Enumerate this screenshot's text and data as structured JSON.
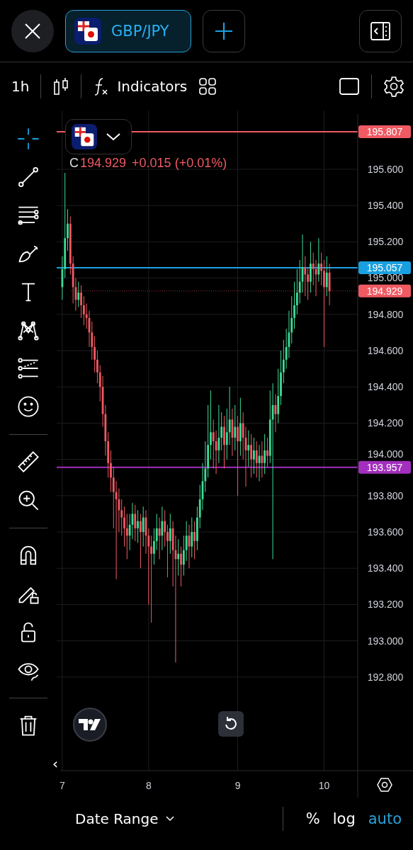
{
  "top_bar": {
    "symbol_tab": {
      "label": "GBP/JPY"
    }
  },
  "toolbar": {
    "interval": "1h",
    "indicators": "Indicators"
  },
  "drawing_tools": [
    {
      "kind": "crosshair",
      "selected": true
    },
    {
      "kind": "trend_line",
      "selected": false
    },
    {
      "kind": "fib",
      "selected": false
    },
    {
      "kind": "brush",
      "selected": false
    },
    {
      "kind": "text",
      "selected": false
    },
    {
      "kind": "pattern",
      "selected": false
    },
    {
      "kind": "projection",
      "selected": false
    },
    {
      "kind": "emoji",
      "selected": false
    },
    {
      "kind": "divider"
    },
    {
      "kind": "ruler",
      "selected": false
    },
    {
      "kind": "zoom",
      "selected": false
    },
    {
      "kind": "divider"
    },
    {
      "kind": "magnet",
      "selected": false
    },
    {
      "kind": "lock_drawing",
      "selected": false
    },
    {
      "kind": "lock",
      "selected": false
    },
    {
      "kind": "hide",
      "selected": false
    },
    {
      "kind": "divider"
    },
    {
      "kind": "trash",
      "selected": false
    }
  ],
  "chart": {
    "legend": {
      "label": "C",
      "close": "194.929",
      "change": "+0.015 (+0.01%)"
    },
    "chart_data": {
      "type": "candlestick",
      "categories": [
        "7",
        null,
        null,
        null,
        null,
        null,
        null,
        null,
        null,
        null,
        null,
        null,
        null,
        null,
        null,
        null,
        null,
        null,
        null,
        null,
        null,
        null,
        null,
        null,
        null,
        null,
        null,
        null,
        null,
        null,
        null,
        null,
        "8",
        null,
        null,
        null,
        null,
        null,
        null,
        null,
        null,
        null,
        null,
        null,
        null,
        null,
        null,
        null,
        null,
        null,
        null,
        null,
        null,
        null,
        null,
        null,
        null,
        null,
        null,
        null,
        null,
        null,
        null,
        null,
        null,
        "9",
        null,
        null,
        null,
        null,
        null,
        null,
        null,
        null,
        null,
        null,
        null,
        null,
        null,
        null,
        null,
        null,
        null,
        null,
        null,
        null,
        null,
        null,
        null,
        null,
        null,
        null,
        null,
        null,
        null,
        null,
        null,
        "10",
        null,
        null
      ],
      "ohlc": [
        [
          194.95,
          195.12,
          194.88,
          195.05
        ],
        [
          195.05,
          195.58,
          195.0,
          195.22
        ],
        [
          195.22,
          195.38,
          195.15,
          195.3
        ],
        [
          195.3,
          195.34,
          195.02,
          195.08
        ],
        [
          195.08,
          195.12,
          194.86,
          194.95
        ],
        [
          194.95,
          195.0,
          194.82,
          194.88
        ],
        [
          194.88,
          194.98,
          194.84,
          194.92
        ],
        [
          194.92,
          194.96,
          194.78,
          194.85
        ],
        [
          194.85,
          194.9,
          194.74,
          194.8
        ],
        [
          194.8,
          194.86,
          194.72,
          194.78
        ],
        [
          194.78,
          194.82,
          194.62,
          194.7
        ],
        [
          194.7,
          194.76,
          194.55,
          194.62
        ],
        [
          194.62,
          194.68,
          194.48,
          194.55
        ],
        [
          194.55,
          194.6,
          194.42,
          194.48
        ],
        [
          194.48,
          194.52,
          194.32,
          194.4
        ],
        [
          194.4,
          194.46,
          194.18,
          194.25
        ],
        [
          194.25,
          194.3,
          194.02,
          194.1
        ],
        [
          194.1,
          194.15,
          193.9,
          193.98
        ],
        [
          193.98,
          194.05,
          193.82,
          193.9
        ],
        [
          193.9,
          193.96,
          193.62,
          193.82
        ],
        [
          193.82,
          193.88,
          193.34,
          193.78
        ],
        [
          193.78,
          193.84,
          193.6,
          193.72
        ],
        [
          193.72,
          193.78,
          193.58,
          193.68
        ],
        [
          193.68,
          193.74,
          193.52,
          193.62
        ],
        [
          193.62,
          193.7,
          193.45,
          193.58
        ],
        [
          193.58,
          193.7,
          193.5,
          193.64
        ],
        [
          193.64,
          193.76,
          193.56,
          193.7
        ],
        [
          193.7,
          193.75,
          193.55,
          193.62
        ],
        [
          193.62,
          193.72,
          193.54,
          193.66
        ],
        [
          193.66,
          193.7,
          193.4,
          193.6
        ],
        [
          193.6,
          193.74,
          193.52,
          193.68
        ],
        [
          193.68,
          193.72,
          193.48,
          193.58
        ],
        [
          193.58,
          193.62,
          193.2,
          193.52
        ],
        [
          193.52,
          193.58,
          193.1,
          193.48
        ],
        [
          193.48,
          193.62,
          193.42,
          193.55
        ],
        [
          193.55,
          193.7,
          193.5,
          193.62
        ],
        [
          193.62,
          193.68,
          193.45,
          193.58
        ],
        [
          193.58,
          193.74,
          193.5,
          193.66
        ],
        [
          193.66,
          193.72,
          193.52,
          193.6
        ],
        [
          193.6,
          193.64,
          193.35,
          193.55
        ],
        [
          193.55,
          193.7,
          193.48,
          193.62
        ],
        [
          193.62,
          193.66,
          193.3,
          193.5
        ],
        [
          193.5,
          193.58,
          192.88,
          193.45
        ],
        [
          193.45,
          193.56,
          193.36,
          193.48
        ],
        [
          193.48,
          193.52,
          193.3,
          193.42
        ],
        [
          193.42,
          193.58,
          193.36,
          193.5
        ],
        [
          193.5,
          193.66,
          193.44,
          193.58
        ],
        [
          193.58,
          193.64,
          193.4,
          193.52
        ],
        [
          193.52,
          193.68,
          193.46,
          193.6
        ],
        [
          193.6,
          193.66,
          193.45,
          193.55
        ],
        [
          193.55,
          193.74,
          193.5,
          193.68
        ],
        [
          193.68,
          193.86,
          193.62,
          193.78
        ],
        [
          193.78,
          193.98,
          193.72,
          193.88
        ],
        [
          193.88,
          194.1,
          193.82,
          193.95
        ],
        [
          193.95,
          194.3,
          193.9,
          194.08
        ],
        [
          194.08,
          194.38,
          194.0,
          194.15
        ],
        [
          194.15,
          194.22,
          193.95,
          194.1
        ],
        [
          194.1,
          194.16,
          193.92,
          194.05
        ],
        [
          194.05,
          194.3,
          193.98,
          194.12
        ],
        [
          194.12,
          194.26,
          194.05,
          194.18
        ],
        [
          194.18,
          194.24,
          193.95,
          194.08
        ],
        [
          194.08,
          194.28,
          194.0,
          194.15
        ],
        [
          194.15,
          194.4,
          194.08,
          194.22
        ],
        [
          194.22,
          194.28,
          194.02,
          194.12
        ],
        [
          194.12,
          194.3,
          194.05,
          194.18
        ],
        [
          194.18,
          194.24,
          193.8,
          194.1
        ],
        [
          194.1,
          194.34,
          194.02,
          194.2
        ],
        [
          194.2,
          194.26,
          194.0,
          194.12
        ],
        [
          194.12,
          194.18,
          193.85,
          194.05
        ],
        [
          194.05,
          194.16,
          193.96,
          194.08
        ],
        [
          194.08,
          194.14,
          193.9,
          194.0
        ],
        [
          194.0,
          194.12,
          193.92,
          194.05
        ],
        [
          194.05,
          194.1,
          193.9,
          193.98
        ],
        [
          193.98,
          194.08,
          193.88,
          194.02
        ],
        [
          194.02,
          194.1,
          193.9,
          193.98
        ],
        [
          193.98,
          194.14,
          193.92,
          194.05
        ],
        [
          194.05,
          194.12,
          193.96,
          194.02
        ],
        [
          194.02,
          194.38,
          193.98,
          194.22
        ],
        [
          194.22,
          194.42,
          193.45,
          194.3
        ],
        [
          194.3,
          194.36,
          194.15,
          194.25
        ],
        [
          194.25,
          194.5,
          194.2,
          194.35
        ],
        [
          194.35,
          194.6,
          194.3,
          194.48
        ],
        [
          194.48,
          194.66,
          194.42,
          194.55
        ],
        [
          194.55,
          194.72,
          194.5,
          194.62
        ],
        [
          194.62,
          194.82,
          194.56,
          194.7
        ],
        [
          194.7,
          194.9,
          194.64,
          194.78
        ],
        [
          194.78,
          194.98,
          194.72,
          194.85
        ],
        [
          194.85,
          195.05,
          194.8,
          194.92
        ],
        [
          194.92,
          195.1,
          194.86,
          194.98
        ],
        [
          194.98,
          195.24,
          194.92,
          195.06
        ],
        [
          195.06,
          195.12,
          194.9,
          195.02
        ],
        [
          195.02,
          195.06,
          194.88,
          194.98
        ],
        [
          194.98,
          195.2,
          194.92,
          195.08
        ],
        [
          195.08,
          195.14,
          194.96,
          195.05
        ],
        [
          195.05,
          195.1,
          194.9,
          195.02
        ],
        [
          195.02,
          195.22,
          194.98,
          195.08
        ],
        [
          195.08,
          195.14,
          194.96,
          195.04
        ],
        [
          195.04,
          195.1,
          194.62,
          194.95
        ],
        [
          194.95,
          195.12,
          194.9,
          195.03
        ],
        [
          195.03,
          195.08,
          194.85,
          194.929
        ]
      ],
      "ylim": [
        192.284,
        195.924
      ],
      "yticks": [
        {
          "value": 195.6,
          "label": "195.600"
        },
        {
          "value": 195.4,
          "label": "195.400"
        },
        {
          "value": 195.2,
          "label": "195.200"
        },
        {
          "value": 195.0,
          "label": "195.000"
        },
        {
          "value": 194.8,
          "label": "194.800"
        },
        {
          "value": 194.6,
          "label": "194.600"
        },
        {
          "value": 194.4,
          "label": "194.400"
        },
        {
          "value": 194.2,
          "label": "194.200"
        },
        {
          "value": 194.0,
          "label": "194.000"
        },
        {
          "value": 193.8,
          "label": "193.800"
        },
        {
          "value": 193.6,
          "label": "193.600"
        },
        {
          "value": 193.4,
          "label": "193.400"
        },
        {
          "value": 193.2,
          "label": "193.200"
        },
        {
          "value": 193.0,
          "label": "193.000"
        },
        {
          "value": 192.8,
          "label": "192.800"
        }
      ],
      "grid": true,
      "ref_lines": [
        {
          "axis": "y",
          "value": 195.807,
          "label": "195.807",
          "color": "#f05a63"
        },
        {
          "axis": "y",
          "value": 195.057,
          "label": "195.057",
          "color": "#1aa0e0"
        },
        {
          "axis": "y",
          "value": 194.929,
          "label": "194.929",
          "color": "#f05a63"
        },
        {
          "axis": "y",
          "value": 193.957,
          "label": "193.957",
          "color": "#a22fbd"
        }
      ]
    },
    "scroll_left": "‹"
  },
  "bottom_bar": {
    "date_range": "Date Range",
    "scale_options": [
      {
        "label": "%",
        "selected": false
      },
      {
        "label": "log",
        "selected": false
      },
      {
        "label": "auto",
        "selected": true
      }
    ]
  }
}
